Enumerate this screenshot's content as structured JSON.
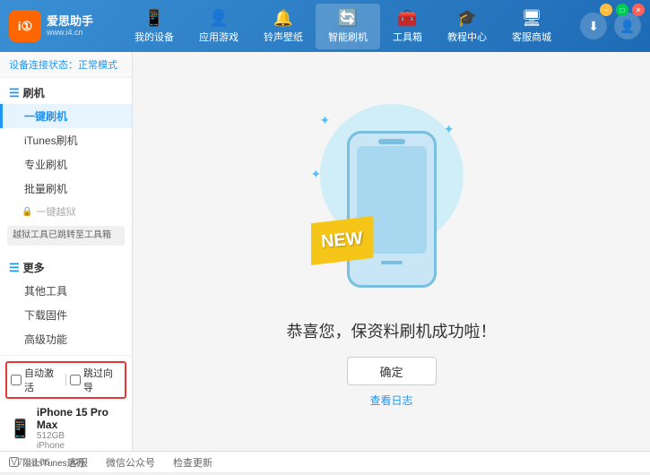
{
  "app": {
    "title": "爱思助手",
    "subtitle": "www.i4.cn",
    "logo_text": "i①"
  },
  "nav": {
    "items": [
      {
        "id": "my-device",
        "label": "我的设备",
        "icon": "📱"
      },
      {
        "id": "apps-games",
        "label": "应用游戏",
        "icon": "👤"
      },
      {
        "id": "ringtone",
        "label": "铃声壁纸",
        "icon": "🔔"
      },
      {
        "id": "smart-flash",
        "label": "智能刷机",
        "icon": "🔄"
      },
      {
        "id": "toolbox",
        "label": "工具箱",
        "icon": "🧰"
      },
      {
        "id": "tutorial",
        "label": "教程中心",
        "icon": "🎓"
      },
      {
        "id": "service",
        "label": "客服商城",
        "icon": "🖥"
      }
    ]
  },
  "header_right": {
    "download_icon": "⬇",
    "user_icon": "👤"
  },
  "sidebar": {
    "status_label": "设备连接状态：",
    "status_value": "正常模式",
    "flash_section": {
      "label": "刷机",
      "items": [
        {
          "id": "one-key-flash",
          "label": "一键刷机",
          "active": true
        },
        {
          "id": "itunes-flash",
          "label": "iTunes刷机"
        },
        {
          "id": "pro-flash",
          "label": "专业刷机"
        },
        {
          "id": "batch-flash",
          "label": "批量刷机"
        }
      ],
      "disabled_item": {
        "label": "一键越狱",
        "notice": "越狱工具已跳转至工具箱"
      }
    },
    "more_section": {
      "label": "更多",
      "items": [
        {
          "id": "other-tools",
          "label": "其他工具"
        },
        {
          "id": "download-firmware",
          "label": "下载固件"
        },
        {
          "id": "advanced",
          "label": "高级功能"
        }
      ]
    },
    "checkbox_auto": "自动激活",
    "checkbox_guide": "跳过向导",
    "device": {
      "name": "iPhone 15 Pro Max",
      "storage": "512GB",
      "type": "iPhone"
    },
    "itunes_label": "阻止iTunes运行"
  },
  "main": {
    "success_title": "恭喜您，保资料刷机成功啦！",
    "confirm_button": "确定",
    "log_link": "查看日志",
    "new_label": "NEW",
    "sparkles": [
      "✦",
      "✦",
      "✦"
    ]
  },
  "statusbar": {
    "version": "V7.98.66",
    "items": [
      "客服",
      "微信公众号",
      "检查更新"
    ]
  }
}
